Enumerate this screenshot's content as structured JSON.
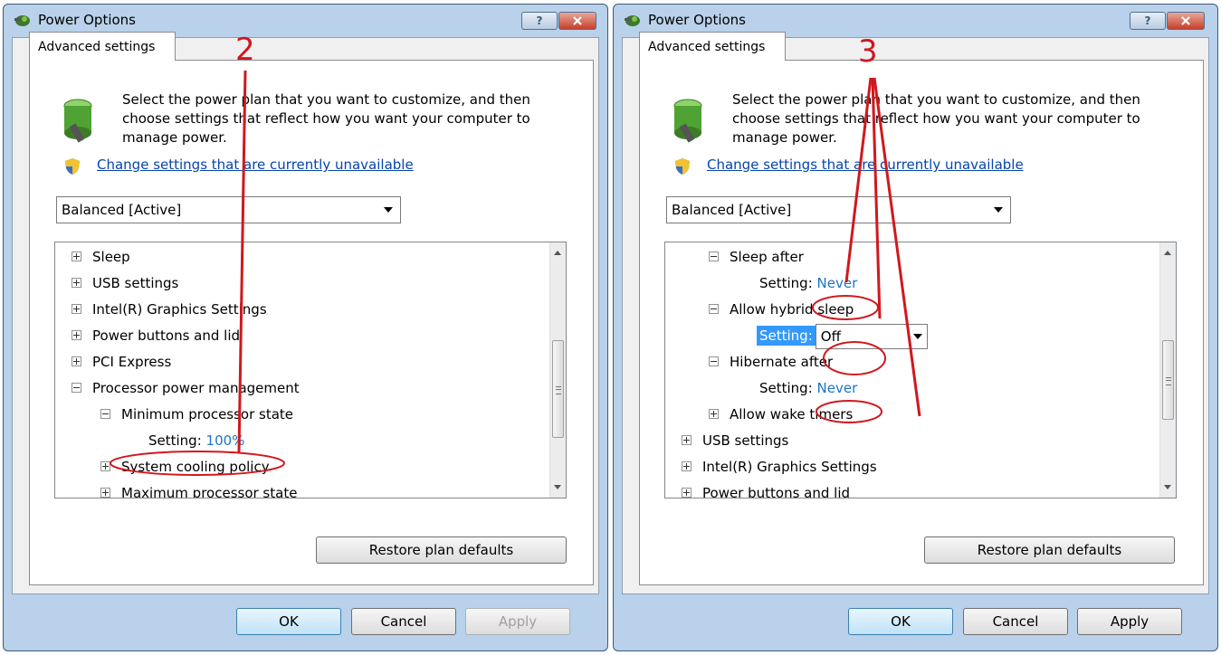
{
  "colors": {
    "annotation": "#d0181e",
    "link": "#0645ad",
    "value": "#1e74c4",
    "highlight": "#3399ff"
  },
  "windows": [
    {
      "title": "Power Options",
      "help_label": "?",
      "close_label": "x",
      "tab": "Advanced settings",
      "description": "Select the power plan that you want to customize, and then choose settings that reflect how you want your computer to manage power.",
      "link": "Change settings that are currently unavailable",
      "plan": "Balanced [Active]",
      "annotation": "2",
      "tree": [
        {
          "label": "Sleep",
          "expander": "plus"
        },
        {
          "label": "USB settings",
          "expander": "plus"
        },
        {
          "label": "Intel(R) Graphics Settings",
          "expander": "plus"
        },
        {
          "label": "Power buttons and lid",
          "expander": "plus"
        },
        {
          "label": "PCI Express",
          "expander": "plus"
        },
        {
          "label": "Processor power management",
          "expander": "minus"
        },
        {
          "label": "Minimum processor state",
          "expander": "minus"
        },
        {
          "setting_label": "Setting:",
          "value": "100%"
        },
        {
          "label": "System cooling policy",
          "expander": "plus"
        },
        {
          "label": "Maximum processor state",
          "expander": "plus"
        }
      ],
      "restore": "Restore plan defaults",
      "ok": "OK",
      "cancel": "Cancel",
      "apply": "Apply",
      "apply_enabled": false
    },
    {
      "title": "Power Options",
      "help_label": "?",
      "close_label": "x",
      "tab": "Advanced settings",
      "description": "Select the power plan that you want to customize, and then choose settings that reflect how you want your computer to manage power.",
      "link": "Change settings that are currently unavailable",
      "plan": "Balanced [Active]",
      "annotation": "3",
      "tree": [
        {
          "label": "Sleep after",
          "expander": "minus"
        },
        {
          "setting_label": "Setting:",
          "value": "Never"
        },
        {
          "label": "Allow hybrid sleep",
          "expander": "minus"
        },
        {
          "setting_label": "Setting:",
          "dropdown_value": "Off"
        },
        {
          "label": "Hibernate after",
          "expander": "minus"
        },
        {
          "setting_label": "Setting:",
          "value": "Never"
        },
        {
          "label": "Allow wake timers",
          "expander": "plus"
        },
        {
          "label": "USB settings",
          "expander": "plus"
        },
        {
          "label": "Intel(R) Graphics Settings",
          "expander": "plus"
        },
        {
          "label": "Power buttons and lid",
          "expander": "plus"
        }
      ],
      "restore": "Restore plan defaults",
      "ok": "OK",
      "cancel": "Cancel",
      "apply": "Apply",
      "apply_enabled": true
    }
  ]
}
